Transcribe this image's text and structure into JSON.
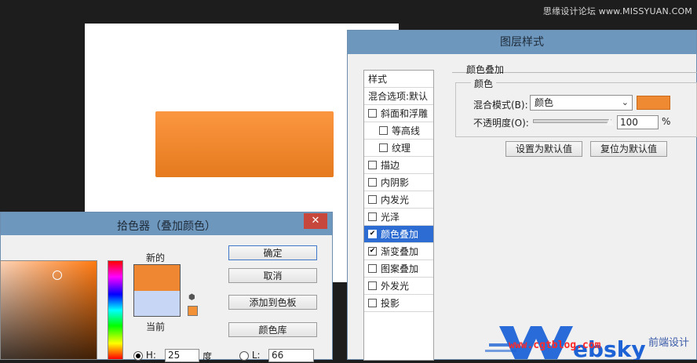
{
  "watermark": {
    "top_text": "思缘设计论坛 www.MISSYUAN.COM",
    "logo_text": "Websky",
    "url_text": "www.cgtblog.com",
    "tagline": "前端设计"
  },
  "colors": {
    "orange": "#f08a32",
    "orange_rect_top": "#fb9640",
    "orange_rect_bottom": "#e57a1e",
    "dialog_title": "#6e97be",
    "selection": "#2d6cd2",
    "current_color": "#c8d6f5",
    "close_button": "#c7473c"
  },
  "layer_style": {
    "title": "图层样式",
    "section_title": "颜色叠加",
    "group_title": "颜色",
    "blend_mode_label": "混合模式(B):",
    "blend_mode_value": "颜色",
    "opacity_label": "不透明度(O):",
    "opacity_value": "100",
    "opacity_unit": "%",
    "opacity_fraction": 1.0,
    "set_default_label": "设置为默认值",
    "reset_default_label": "复位为默认值",
    "styles": [
      {
        "label": "样式",
        "type": "header"
      },
      {
        "label": "混合选项:默认",
        "type": "header"
      },
      {
        "label": "斜面和浮雕",
        "checked": false
      },
      {
        "label": "等高线",
        "checked": false,
        "indent": true
      },
      {
        "label": "纹理",
        "checked": false,
        "indent": true
      },
      {
        "label": "描边",
        "checked": false
      },
      {
        "label": "内阴影",
        "checked": false
      },
      {
        "label": "内发光",
        "checked": false
      },
      {
        "label": "光泽",
        "checked": false
      },
      {
        "label": "颜色叠加",
        "checked": true,
        "selected": true
      },
      {
        "label": "渐变叠加",
        "checked": true
      },
      {
        "label": "图案叠加",
        "checked": false
      },
      {
        "label": "外发光",
        "checked": false
      },
      {
        "label": "投影",
        "checked": false
      }
    ]
  },
  "color_picker": {
    "title": "拾色器（叠加颜色）",
    "close_glyph": "✕",
    "new_label": "新的",
    "current_label": "当前",
    "ok_label": "确定",
    "cancel_label": "取消",
    "add_to_swatches_label": "添加到色板",
    "color_library_label": "颜色库",
    "h_label": "H:",
    "h_value": "25",
    "h_unit": "度",
    "l_label": "L:",
    "l_value": "66",
    "new_color": "#ef8732",
    "cube_icon": "cube-icon"
  }
}
